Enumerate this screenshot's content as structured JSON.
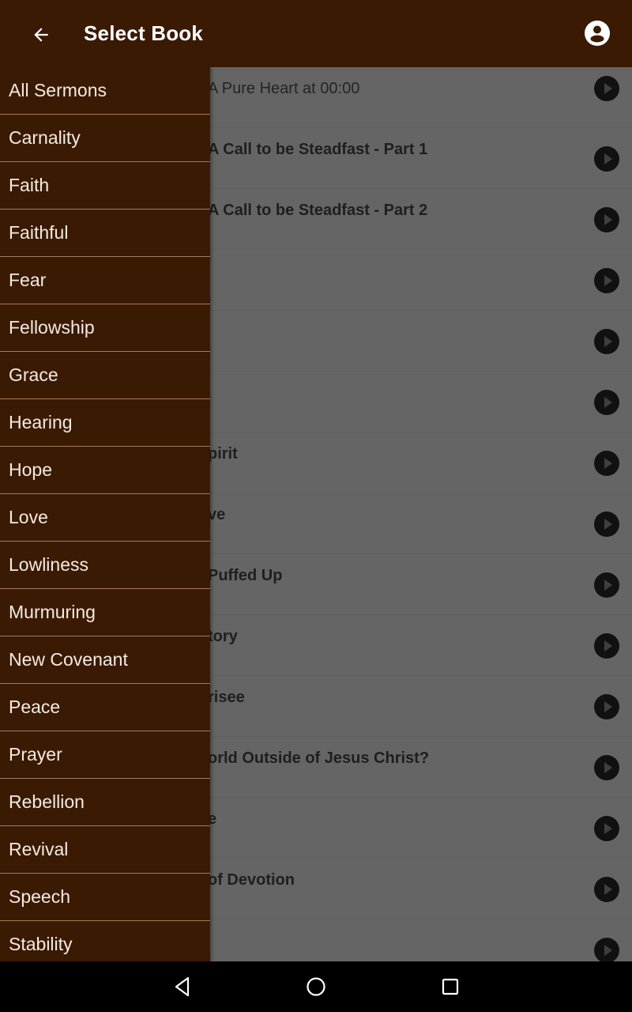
{
  "app_bar": {
    "title": "Select Book",
    "back_icon": "arrow-back-icon",
    "account_icon": "account-circle-icon",
    "background_color": "#3b1a04"
  },
  "drawer": {
    "items": [
      {
        "label": "All Sermons"
      },
      {
        "label": "Carnality"
      },
      {
        "label": "Faith"
      },
      {
        "label": "Faithful"
      },
      {
        "label": "Fear"
      },
      {
        "label": "Fellowship"
      },
      {
        "label": "Grace"
      },
      {
        "label": "Hearing"
      },
      {
        "label": "Hope"
      },
      {
        "label": "Love"
      },
      {
        "label": "Lowliness"
      },
      {
        "label": "Murmuring"
      },
      {
        "label": "New Covenant"
      },
      {
        "label": "Peace"
      },
      {
        "label": "Prayer"
      },
      {
        "label": "Rebellion"
      },
      {
        "label": "Revival"
      },
      {
        "label": "Speech"
      },
      {
        "label": "Stability"
      }
    ]
  },
  "sermons": {
    "rows": [
      {
        "title": "A Pure Heart at 00:00",
        "style": "regular"
      },
      {
        "title": "A Call to be Steadfast - Part 1",
        "style": "bold"
      },
      {
        "title": "A Call to be Steadfast - Part 2",
        "style": "bold"
      },
      {
        "title": "",
        "style": "bold"
      },
      {
        "title": "",
        "style": "bold"
      },
      {
        "title": "",
        "style": "bold"
      },
      {
        "title": "pirit",
        "style": "bold"
      },
      {
        "title": "ve",
        "style": "bold"
      },
      {
        "title": "Puffed Up",
        "style": "bold"
      },
      {
        "title": "tory",
        "style": "bold"
      },
      {
        "title": "risee",
        "style": "bold"
      },
      {
        "title": "orld Outside of Jesus Christ?",
        "style": "bold"
      },
      {
        "title": "e",
        "style": "bold"
      },
      {
        "title": "of Devotion",
        "style": "bold"
      },
      {
        "title": "",
        "style": "bold"
      }
    ],
    "play_icon": "play-circle-icon"
  },
  "nav_bar": {
    "back_icon": "nav-back-icon",
    "home_icon": "nav-home-icon",
    "recents_icon": "nav-recents-icon"
  }
}
